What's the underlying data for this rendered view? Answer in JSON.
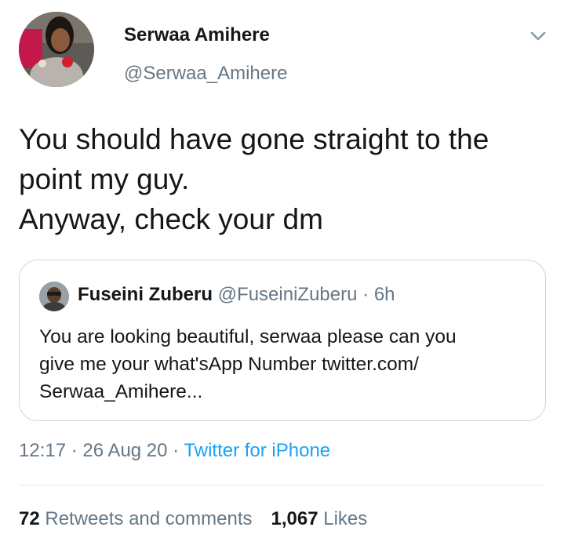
{
  "author": {
    "name": "Serwaa Amihere",
    "handle": "@Serwaa_Amihere"
  },
  "tweet": {
    "lines": [
      "You should have gone straight to the",
      "point my guy.",
      "Anyway, check your dm"
    ]
  },
  "quoted": {
    "name": "Fuseini Zuberu",
    "handle": "@FuseiniZuberu",
    "separator": "·",
    "time": "6h",
    "lines": [
      "You are looking beautiful, serwaa please can you",
      "give me your what'sApp Number twitter.com/",
      "Serwaa_Amihere..."
    ]
  },
  "meta": {
    "time": "12:17",
    "sep1": " · ",
    "date": "26 Aug 20",
    "sep2": " · ",
    "source": "Twitter for iPhone"
  },
  "stats": {
    "retweets_count": "72",
    "retweets_label": "Retweets and comments",
    "likes_count": "1,067",
    "likes_label": "Likes"
  },
  "icons": {
    "caret": "chevron-down-icon"
  },
  "colors": {
    "text": "#14171a",
    "secondary": "#657786",
    "link": "#1da1f2",
    "border": "#ccd6dd"
  }
}
